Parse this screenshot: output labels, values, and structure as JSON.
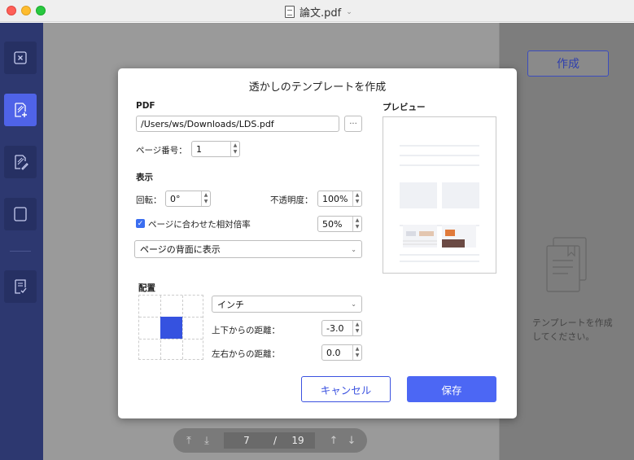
{
  "window": {
    "title": "論文.pdf"
  },
  "sidebar": {
    "items": [
      {
        "icon": "close-icon"
      },
      {
        "icon": "add-watermark-icon",
        "active": true
      },
      {
        "icon": "edit-watermark-icon"
      },
      {
        "icon": "blank-page-icon"
      },
      {
        "icon": "checklist-icon"
      }
    ]
  },
  "pager": {
    "current": "7",
    "separator": "/",
    "total": "19"
  },
  "right_panel": {
    "create_label": "作成",
    "empty_text": "テンプレートを作成してください。"
  },
  "dialog": {
    "title": "透かしのテンプレートを作成",
    "pdf_label": "PDF",
    "pdf_path": "/Users/ws/Downloads/LDS.pdf",
    "browse_label": "···",
    "page_number_label": "ページ番号：",
    "page_number": "1",
    "display_section": "表示",
    "rotation_label": "回転：",
    "rotation_value": "0°",
    "opacity_label": "不透明度：",
    "opacity_value": "100%",
    "fit_page_label": "ページに合わせた相対倍率",
    "fit_page_checked": true,
    "scale_value": "50%",
    "layer_option": "ページの背面に表示",
    "layout_section": "配置",
    "unit_option": "インチ",
    "vertical_label": "上下からの距離：",
    "vertical_value": "-3.0",
    "horizontal_label": "左右からの距離：",
    "horizontal_value": "0.0",
    "preview_label": "プレビュー",
    "cancel_label": "キャンセル",
    "save_label": "保存"
  },
  "colors": {
    "sidebar": "#2d3870",
    "accent": "#4c67f4",
    "overlay": "#9a9a9a"
  }
}
